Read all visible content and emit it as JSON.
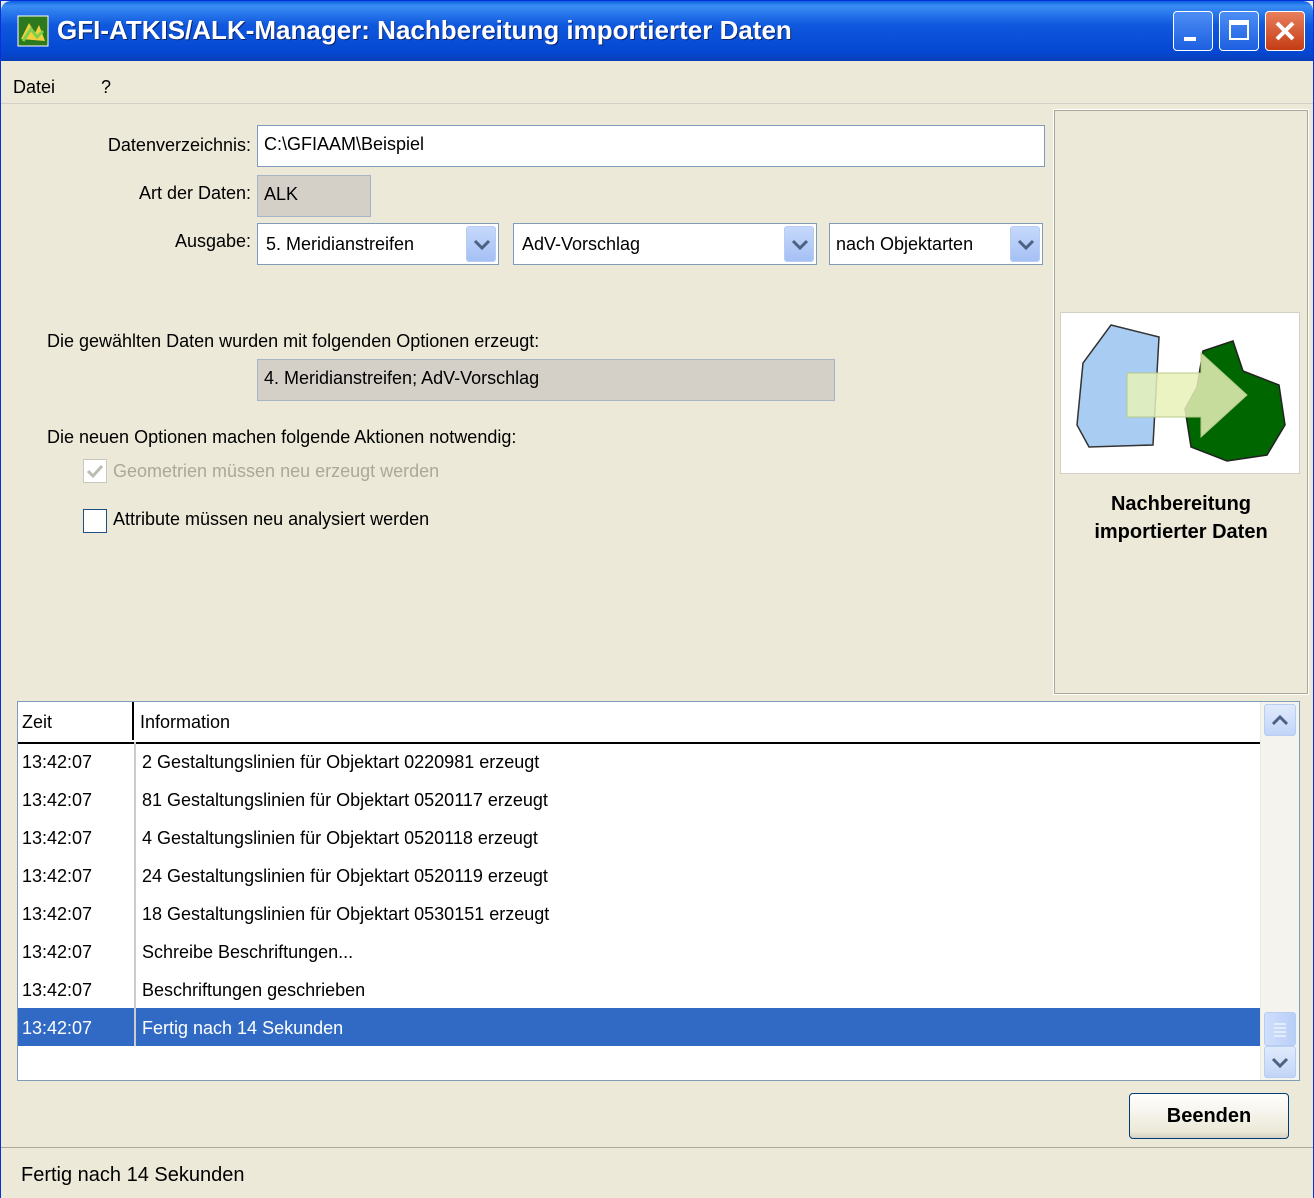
{
  "window": {
    "title": "GFI-ATKIS/ALK-Manager: Nachbereitung importierter Daten"
  },
  "menu": {
    "items": [
      "Datei",
      "?"
    ]
  },
  "form": {
    "datadir_label": "Datenverzeichnis:",
    "datadir_value": "C:\\GFIAAM\\Beispiel",
    "type_label": "Art der Daten:",
    "type_value": "ALK",
    "output_label": "Ausgabe:",
    "output_strip": "5. Meridianstreifen",
    "output_profile": "AdV-Vorschlag",
    "output_mode": "nach Objektarten",
    "created_label": "Die gewählten Daten wurden mit folgenden Optionen erzeugt:",
    "created_value": "4. Meridianstreifen;   AdV-Vorschlag",
    "actions_label": "Die neuen Optionen machen folgende Aktionen notwendig:",
    "chk_geometry": "Geometrien müssen neu erzeugt werden",
    "chk_geometry_checked": true,
    "chk_attributes": "Attribute müssen neu analysiert werden",
    "chk_attributes_checked": false
  },
  "side": {
    "caption": "Nachbereitung importierter Daten"
  },
  "log": {
    "columns": [
      "Zeit",
      "Information"
    ],
    "rows": [
      {
        "time": "13:42:07",
        "info": "2 Gestaltungslinien für Objektart 0220981 erzeugt"
      },
      {
        "time": "13:42:07",
        "info": "81 Gestaltungslinien für Objektart 0520117 erzeugt"
      },
      {
        "time": "13:42:07",
        "info": "4 Gestaltungslinien für Objektart 0520118 erzeugt"
      },
      {
        "time": "13:42:07",
        "info": "24 Gestaltungslinien für Objektart 0520119 erzeugt"
      },
      {
        "time": "13:42:07",
        "info": "18 Gestaltungslinien für Objektart 0530151 erzeugt"
      },
      {
        "time": "13:42:07",
        "info": "Schreibe Beschriftungen..."
      },
      {
        "time": "13:42:07",
        "info": "Beschriftungen geschrieben"
      },
      {
        "time": "13:42:07",
        "info": "Fertig nach 14 Sekunden"
      }
    ],
    "selected_index": 7
  },
  "buttons": {
    "quit": "Beenden"
  },
  "status": {
    "text": "Fertig nach 14 Sekunden"
  },
  "colors": {
    "selection": "#316ac5",
    "titlebar": "#0447d2"
  }
}
